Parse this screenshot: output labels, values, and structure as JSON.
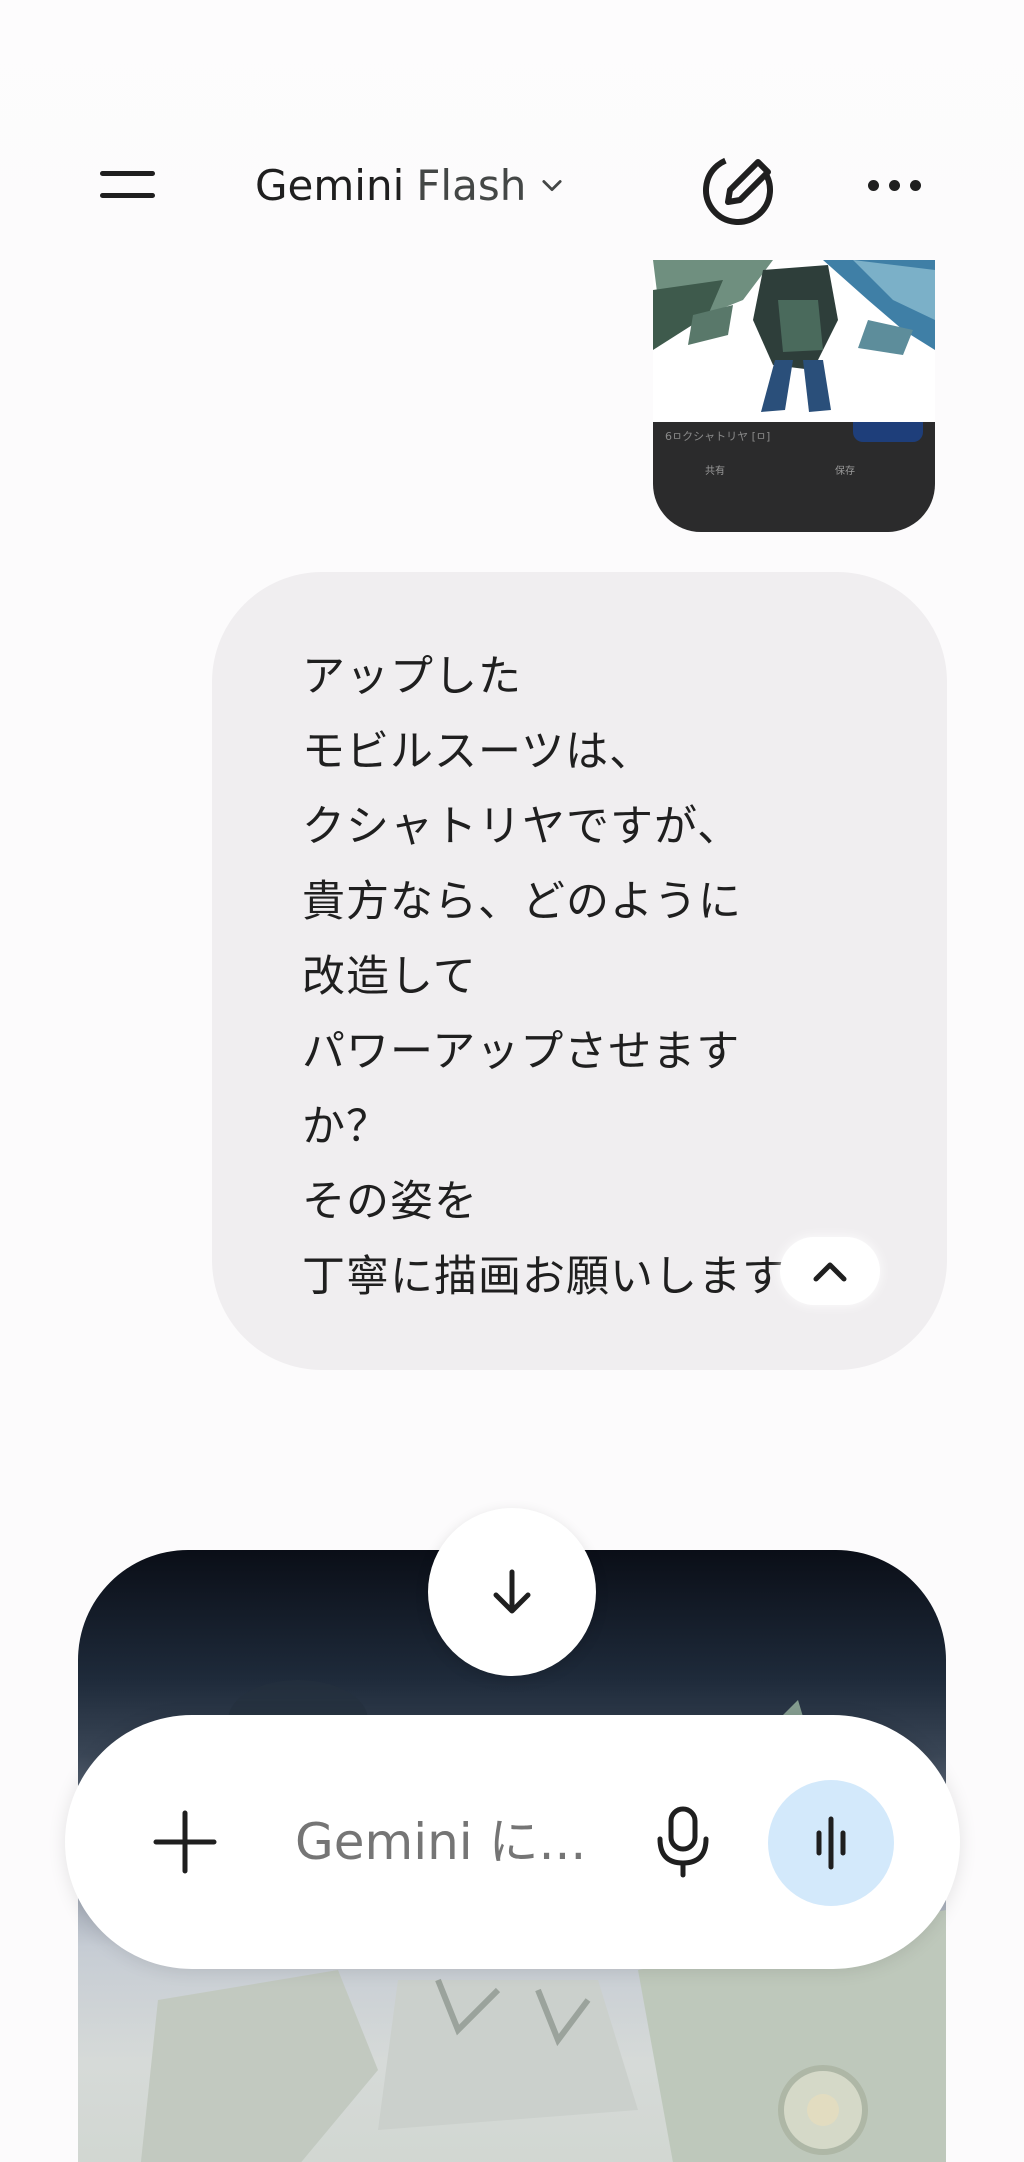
{
  "header": {
    "model_name": "Gemini",
    "model_variant": "Flash",
    "menu_icon": "menu-icon",
    "new_chat_icon": "edit-pen-icon",
    "more_icon": "more-horizontal-icon"
  },
  "uploaded_image": {
    "panel_caption": "6ㅁクシャトリヤ [ㅁ]",
    "panel_button_1": "共有",
    "panel_button_2": "保存"
  },
  "user_message": {
    "lines": [
      "アップした",
      "モビルスーツは、",
      "クシャトリヤですが、",
      "貴方なら、どのように",
      "改造して",
      "パワーアップさせます",
      "か？",
      "その姿を",
      "丁寧に描画お願いします"
    ],
    "collapse_icon": "chevron-up-icon"
  },
  "scroll_down_icon": "arrow-down-icon",
  "input": {
    "placeholder": "Gemini に...",
    "add_icon": "plus-icon",
    "mic_icon": "mic-icon",
    "live_icon": "live-waveform-icon",
    "accent_color": "#d3e9fb"
  }
}
